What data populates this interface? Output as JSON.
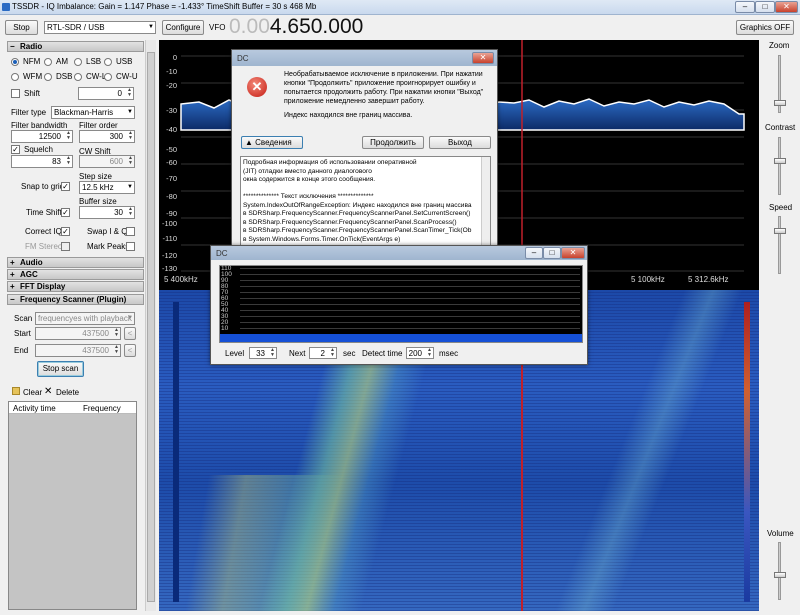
{
  "window": {
    "title": "TSSDR - IQ Imbalance: Gain = 1.147 Phase = -1.433° TimeShift Buffer = 30 s  468 Mb",
    "min": "–",
    "max": "□",
    "close": "✕"
  },
  "toolbar": {
    "stop_label": "Stop",
    "device": "RTL-SDR / USB",
    "configure_label": "Configure",
    "vfo_label": "VFO",
    "vfo_dim": "0.00",
    "vfo_bright": "4.650.000",
    "graphics_label": "Graphics OFF"
  },
  "radio": {
    "header": "Radio",
    "modes": [
      "NFM",
      "AM",
      "LSB",
      "USB",
      "WFM",
      "DSB",
      "CW-L",
      "CW-U"
    ],
    "selected_mode": "NFM",
    "shift_label": "Shift",
    "shift_value": "0",
    "filter_type_label": "Filter type",
    "filter_type": "Blackman-Harris",
    "filter_bandwidth_label": "Filter bandwidth",
    "filter_bandwidth": "12500",
    "filter_order_label": "Filter order",
    "filter_order": "300",
    "squelch_label": "Squelch",
    "squelch_value": "83",
    "cw_shift_label": "CW Shift",
    "cw_shift_value": "600",
    "step_size_label": "Step size",
    "step_size": "12.5 kHz",
    "snap_label": "Snap to grid",
    "buffer_size_label": "Buffer size",
    "buffer_size": "30",
    "time_shift_label": "Time Shift",
    "correct_iq_label": "Correct IQ",
    "swap_iq_label": "Swap I & Q",
    "fm_stereo_label": "FM Stereo",
    "mark_peaks_label": "Mark Peaks"
  },
  "sections": {
    "audio": "Audio",
    "agc": "AGC",
    "fft": "FFT Display",
    "scanner": "Frequency Scanner (Plugin)"
  },
  "scanner": {
    "scan_label": "Scan",
    "scan_mode": "frequencyes with playback",
    "start_label": "Start",
    "start_value": "437500",
    "end_label": "End",
    "end_value": "437500",
    "stop_scan_label": "Stop scan",
    "clear_label": "Clear",
    "delete_label": "Delete",
    "col_activity": "Activity time",
    "col_frequency": "Frequency"
  },
  "spectrum": {
    "db_labels": [
      "0",
      "-10",
      "-20",
      "-30",
      "-40",
      "-50",
      "-60",
      "-70",
      "-80",
      "-90",
      "-100",
      "-110",
      "-120",
      "-130"
    ],
    "freq_labels": [
      "5 400kHz",
      "5 100kHz",
      "5 312.6kHz"
    ]
  },
  "right_panel": {
    "zoom": "Zoom",
    "contrast": "Contrast",
    "speed": "Speed",
    "volume": "Volume"
  },
  "error_dialog": {
    "title": "DC",
    "message": "Необрабатываемое исключение в приложении. При нажатии кнопки \"Продолжить\" приложение проигнорирует ошибку и попытается продолжить работу. При нажатии кнопки \"Выход\" приложение немедленно завершит работу.",
    "message2": "Индекс находился вне границ массива.",
    "details_label": "Сведения",
    "continue_label": "Продолжить",
    "exit_label": "Выход",
    "details_lines": [
      "Подробная информация об использовании оперативной",
      "(JIT) отладки вместо данного диалогового",
      "окна содержится в конце этого сообщения.",
      "",
      "************** Текст исключения **************",
      "System.IndexOutOfRangeException: Индекс находился вне границ массива",
      "   в SDRSharp.FrequencyScanner.FrequencyScannerPanel.SetCurrentScreen()",
      "   в SDRSharp.FrequencyScanner.FrequencyScannerPanel.ScanProcess()",
      "   в SDRSharp.FrequencyScanner.FrequencyScannerPanel.ScanTimer_Tick(Ob",
      "   в System.Windows.Forms.Timer.OnTick(EventArgs e)"
    ]
  },
  "scanner_dialog": {
    "title": "DC",
    "scale": [
      "110",
      "100",
      "90",
      "80",
      "70",
      "60",
      "50",
      "40",
      "30",
      "20",
      "10"
    ],
    "level_label": "Level",
    "level_value": "33",
    "next_label": "Next",
    "next_value": "2",
    "sec_label": "sec",
    "detect_label": "Detect time",
    "detect_value": "200",
    "msec_label": "msec"
  }
}
